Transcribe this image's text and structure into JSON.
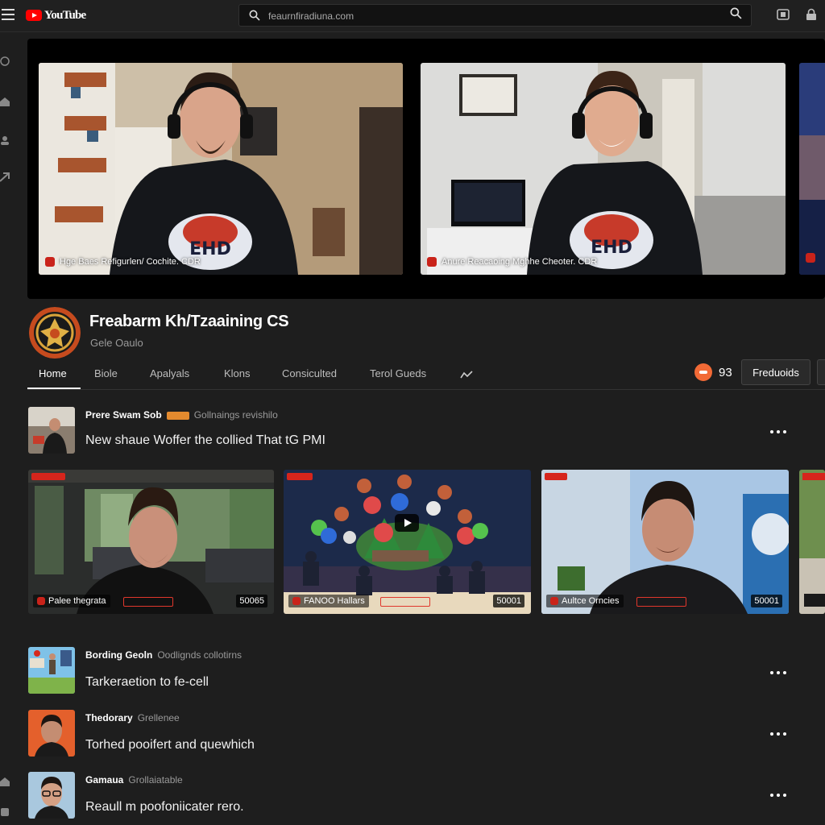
{
  "app": {
    "logo_text": "YouTube",
    "search_placeholder": "feaurnfiradiuna.com"
  },
  "featured": {
    "streams": [
      {
        "label": "Hge Baes Refigurlen/ Cochite. CDR"
      },
      {
        "label": "Anure Reacaoing Mghhe Cheoter. CDR"
      }
    ]
  },
  "channel": {
    "name": "Freabarm Kh/Tzaaining CS",
    "handle": "Gele Oaulo",
    "subscriber_count": "93",
    "follow_label": "Freduoids"
  },
  "tabs": [
    {
      "label": "Home",
      "active": true
    },
    {
      "label": "Biole"
    },
    {
      "label": "Apalyals"
    },
    {
      "label": "Klons"
    },
    {
      "label": "Consiculted"
    },
    {
      "label": "Terol Gueds"
    }
  ],
  "posts": [
    {
      "author": "Prere Swam Sob",
      "meta": "Gollnaings revishilo",
      "text": "New shaue Woffer the collied That tG PMI"
    },
    {
      "author": "Bording Geoln",
      "meta": "Oodlignds collotirns",
      "text": "Tarkeraetion to fe-cell"
    },
    {
      "author": "Thedorary",
      "meta": "Grellenee",
      "text": "Torhed pooifert and quewhich"
    },
    {
      "author": "Gamaua",
      "meta": "Grollaiatable",
      "text": "Reaull m poofoniicater rero."
    }
  ],
  "videos": [
    {
      "title": "Palee thegrata",
      "duration": "50065"
    },
    {
      "title": "FANOO Hallars",
      "duration": "50001"
    },
    {
      "title": "Aultce Orncies",
      "duration": "50001"
    }
  ],
  "colors": {
    "background": "#1e1e1e",
    "accent_red": "#ff0000",
    "subscriber_orange": "#f26a36"
  }
}
